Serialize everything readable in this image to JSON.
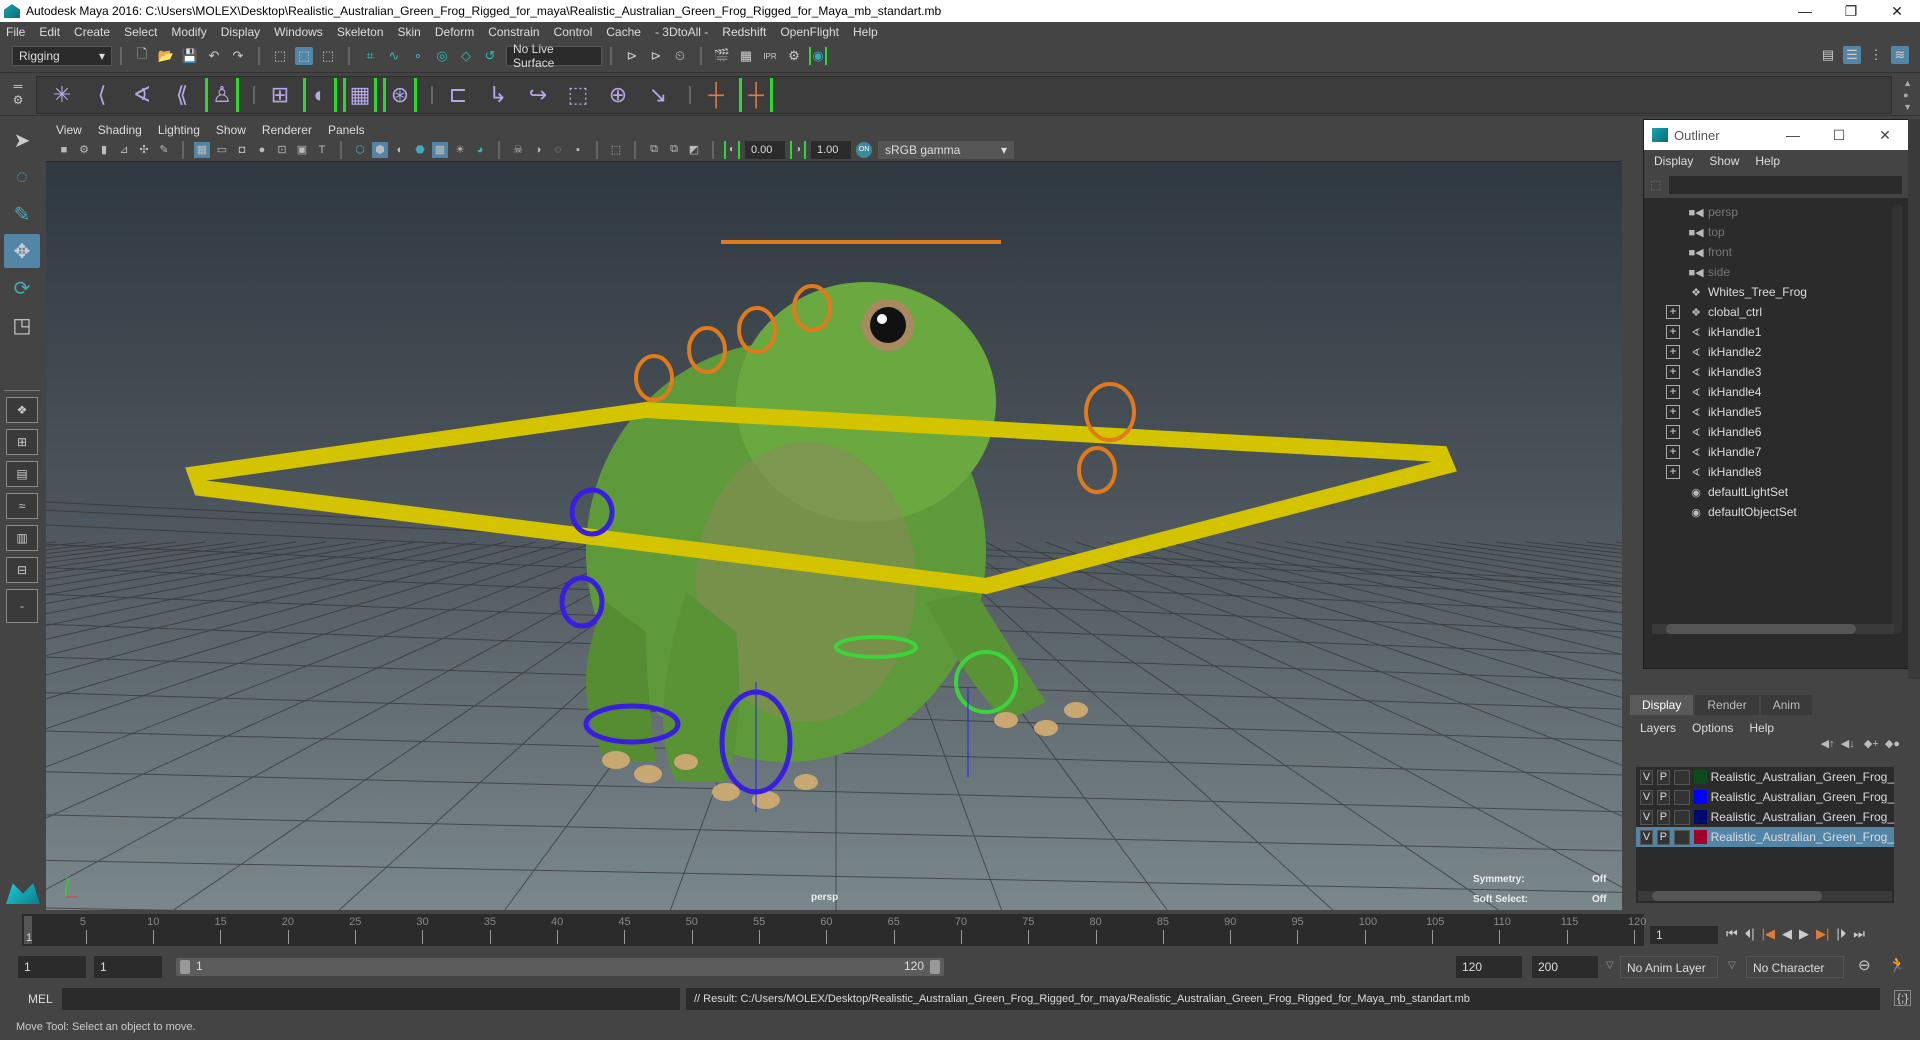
{
  "window": {
    "title": "Autodesk Maya 2016: C:\\Users\\MOLEX\\Desktop\\Realistic_Australian_Green_Frog_Rigged_for_maya\\Realistic_Australian_Green_Frog_Rigged_for_Maya_mb_standart.mb",
    "minimize": "—",
    "restore": "❐",
    "close": "✕"
  },
  "menubar": [
    "File",
    "Edit",
    "Create",
    "Select",
    "Modify",
    "Display",
    "Windows",
    "Skeleton",
    "Skin",
    "Deform",
    "Constrain",
    "Control",
    "Cache",
    "- 3DtoAll -",
    "Redshift",
    "OpenFlight",
    "Help"
  ],
  "status_toolbar": {
    "menuset": "Rigging",
    "live_surface": "No Live Surface"
  },
  "panel_menu": [
    "View",
    "Shading",
    "Lighting",
    "Show",
    "Renderer",
    "Panels"
  ],
  "view_toolbar": {
    "exposure": "0.00",
    "gamma": "1.00",
    "color_space": "sRGB gamma"
  },
  "viewport": {
    "camera_label": "persp",
    "hud": [
      {
        "label": "Symmetry:",
        "value": "Off"
      },
      {
        "label": "Soft Select:",
        "value": "Off"
      }
    ]
  },
  "outliner": {
    "title": "Outliner",
    "menu": [
      "Display",
      "Show",
      "Help"
    ],
    "items": [
      {
        "name": "persp",
        "icon": "camera-icon",
        "expandable": false,
        "dim": true
      },
      {
        "name": "top",
        "icon": "camera-icon",
        "expandable": false,
        "dim": true
      },
      {
        "name": "front",
        "icon": "camera-icon",
        "expandable": false,
        "dim": true
      },
      {
        "name": "side",
        "icon": "camera-icon",
        "expandable": false,
        "dim": true
      },
      {
        "name": "Whites_Tree_Frog",
        "icon": "mesh-icon",
        "expandable": false,
        "dim": false
      },
      {
        "name": "clobal_ctrl",
        "icon": "mesh-icon",
        "expandable": true,
        "dim": false
      },
      {
        "name": "ikHandle1",
        "icon": "ikhandle-icon",
        "expandable": true,
        "dim": false
      },
      {
        "name": "ikHandle2",
        "icon": "ikhandle-icon",
        "expandable": true,
        "dim": false
      },
      {
        "name": "ikHandle3",
        "icon": "ikhandle-icon",
        "expandable": true,
        "dim": false
      },
      {
        "name": "ikHandle4",
        "icon": "ikhandle-icon",
        "expandable": true,
        "dim": false
      },
      {
        "name": "ikHandle5",
        "icon": "ikhandle-icon",
        "expandable": true,
        "dim": false
      },
      {
        "name": "ikHandle6",
        "icon": "ikhandle-icon",
        "expandable": true,
        "dim": false
      },
      {
        "name": "ikHandle7",
        "icon": "ikhandle-icon",
        "expandable": true,
        "dim": false
      },
      {
        "name": "ikHandle8",
        "icon": "ikhandle-icon",
        "expandable": true,
        "dim": false
      },
      {
        "name": "defaultLightSet",
        "icon": "set-icon",
        "expandable": false,
        "dim": false
      },
      {
        "name": "defaultObjectSet",
        "icon": "set-icon",
        "expandable": false,
        "dim": false
      }
    ]
  },
  "layer_editor": {
    "tabs": [
      {
        "label": "Display",
        "active": true
      },
      {
        "label": "Render",
        "active": false
      },
      {
        "label": "Anim",
        "active": false
      }
    ],
    "menu": [
      "Layers",
      "Options",
      "Help"
    ],
    "layers": [
      {
        "v": "V",
        "p": "P",
        "name": "Realistic_Australian_Green_Frog_",
        "color": "#0d4a1e",
        "selected": false
      },
      {
        "v": "V",
        "p": "P",
        "name": "Realistic_Australian_Green_Frog_",
        "color": "#0000ff",
        "selected": false
      },
      {
        "v": "V",
        "p": "P",
        "name": "Realistic_Australian_Green_Frog_",
        "color": "#000a6e",
        "selected": false
      },
      {
        "v": "V",
        "p": "P",
        "name": "Realistic_Australian_Green_Frog_",
        "color": "#a0002a",
        "selected": true
      }
    ]
  },
  "timeline": {
    "start": 1,
    "end": 120,
    "current_frame": "1",
    "ticks": [
      "5",
      "10",
      "15",
      "20",
      "25",
      "30",
      "35",
      "40",
      "45",
      "50",
      "55",
      "60",
      "65",
      "70",
      "75",
      "80",
      "85",
      "90",
      "95",
      "100",
      "105",
      "110",
      "115",
      "120"
    ],
    "current_marker": "1"
  },
  "range": {
    "start_field": "1",
    "playback_start": "1",
    "range_start_label": "1",
    "range_end_label": "120",
    "playback_end": "120",
    "end_field": "200",
    "anim_layer": "No Anim Layer",
    "character_set": "No Character Set"
  },
  "command_line": {
    "label": "MEL",
    "input": "",
    "result": "// Result: C:/Users/MOLEX/Desktop/Realistic_Australian_Green_Frog_Rigged_for_maya/Realistic_Australian_Green_Frog_Rigged_for_Maya_mb_standart.mb"
  },
  "status_line": "Move Tool: Select an object to move.",
  "colors": {
    "accent": "#5285a6",
    "highlight_green": "#2fd62f",
    "ctrl_yellow": "#d4c400",
    "ctrl_orange": "#e07a1a",
    "ctrl_blue": "#3a1ee0"
  }
}
